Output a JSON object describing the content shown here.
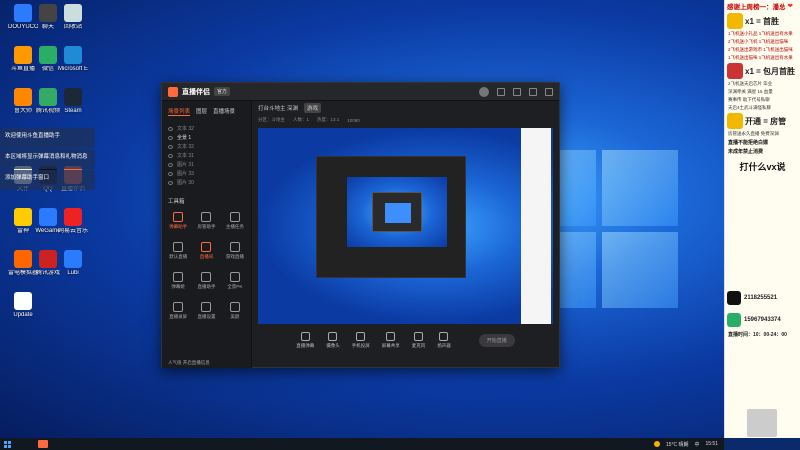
{
  "desktop": {
    "icons": [
      {
        "label": "DOUYUCOM",
        "color": "#2b7bff"
      },
      {
        "label": "聊天",
        "color": "#444"
      },
      {
        "label": "回收站",
        "color": "#cdd"
      },
      {
        "label": "斗鱼直播",
        "color": "#f90"
      },
      {
        "label": "微信",
        "color": "#2aae67"
      },
      {
        "label": "Microsoft Edge",
        "color": "#1f8ad6"
      },
      {
        "label": "鲁大师",
        "color": "#f80"
      },
      {
        "label": "腾讯视频",
        "color": "#3a6"
      },
      {
        "label": "Steam",
        "color": "#1b2838"
      },
      {
        "label": "文件",
        "color": "#fff"
      },
      {
        "label": "QQ",
        "color": "#111"
      },
      {
        "label": "直播伴侣",
        "color": "#ff6a3d"
      },
      {
        "label": "雷神",
        "color": "#ffcc00"
      },
      {
        "label": "WeGame",
        "color": "#2b7bff"
      },
      {
        "label": "网易云音乐",
        "color": "#e22"
      },
      {
        "label": "雷电模拟器",
        "color": "#f60"
      },
      {
        "label": "腾讯游戏",
        "color": "#c22"
      },
      {
        "label": "Lubi",
        "color": "#2b7bff"
      },
      {
        "label": "Update",
        "color": "#fff"
      }
    ],
    "notifications": [
      "欢迎使用斗鱼直播助手",
      "本区域将显示弹幕消息和礼物消息",
      "添加弹幕助手窗口"
    ]
  },
  "app": {
    "name": "直播伴侣",
    "badge": "官方",
    "side_tabs": [
      "场景列表",
      "图层",
      "直播场景"
    ],
    "scenes": [
      "文本 32",
      "全景 1",
      "文本 32",
      "文本 31",
      "图片 31",
      "图片 33",
      "图片 30"
    ],
    "tools_title": "工具箱",
    "tools": [
      "弹幕助手",
      "房管助手",
      "主播任务",
      "默认直播",
      "直播间",
      "游戏直播",
      "弹幕姬",
      "直播助手",
      "全景PK",
      "直播录屏",
      "直播设置",
      "美颜"
    ],
    "sidebar_footer": "人气值 开启直播信息",
    "main_title": "打台斗地主 深渊",
    "main_tag": "游戏",
    "sub_stats": [
      "分区：斗地主",
      "人数：1",
      "热度：13.1",
      "10080"
    ],
    "toolbar": [
      "直播弹幕",
      "摄像头",
      "手机投屏",
      "屏幕共享",
      "麦克风",
      "扬声器"
    ],
    "start_button": "开始直播"
  },
  "chat": {
    "header": "感谢上周榜一：",
    "header_name": "潘总",
    "lines_top": [
      {
        "big": "x1 = 首胜",
        "color": "#f2b800"
      },
      {
        "big": "x1 = 包月首胜",
        "color": "#c33"
      },
      {
        "big": "开通 = 房管",
        "color": "#f2b800"
      }
    ],
    "small_lines": [
      "1飞机送小礼品 1飞机送出有水果",
      "2飞机送小飞机 1飞机送出猫咪",
      "2飞机送出游戏币 1飞机送出猫咪",
      "1飞机送出猫咪 1飞机送出有水果",
      "2飞机送天启芯片 毕业",
      "深渊牵关 满星 15 血量",
      "赛事传 助下代号私聊",
      "天启4土武斗满怪私聊",
      "房管送永久直播 免费深渊",
      "直播不能拒绝白嫖",
      "未成年禁止消费"
    ],
    "big_text": "打什么vx说",
    "qq": "2118255521",
    "wechat": "15967943374",
    "schedule": "直播时间：10：00-24：00"
  },
  "taskbar": {
    "weather": "15°C 晴朗",
    "time": "15:51",
    "lang": "中"
  }
}
